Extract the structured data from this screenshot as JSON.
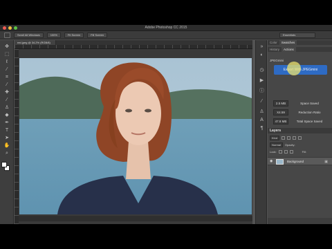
{
  "app": {
    "title": "Adobe Photoshop CC 2015"
  },
  "options_bar": {
    "button_1": "Scroll All Windows",
    "zoom": "100%",
    "button_2": "Fit Screen",
    "button_3": "Fill Screen",
    "workspace": "Essentials"
  },
  "document": {
    "tab_label": "red.jpeg @ 34.2% (RGB/8)"
  },
  "panels": {
    "top_tabs": [
      "Color",
      "Swatches"
    ],
    "mid_tabs": [
      "History",
      "Actions"
    ],
    "jpeg_header": "JPEGmini",
    "export_button": "Export With JPEGmini",
    "stats": [
      {
        "value": "2.5 MB",
        "label": "Space Saved"
      },
      {
        "value": "X4.59",
        "label": "Reduction Ratio"
      },
      {
        "value": "47.8 MB",
        "label": "Total Space Saved"
      }
    ],
    "layers": {
      "title": "Layers",
      "filter_kind": "Kind",
      "blend_mode": "Normal",
      "opacity_label": "Opacity:",
      "lock_label": "Lock:",
      "fill_label": "Fill:",
      "layer_name": "Background"
    }
  },
  "colors": {
    "accent_button": "#2e6bc4",
    "close": "#ed5a51",
    "minimize": "#f4bd3e",
    "maximize": "#5cc245"
  }
}
